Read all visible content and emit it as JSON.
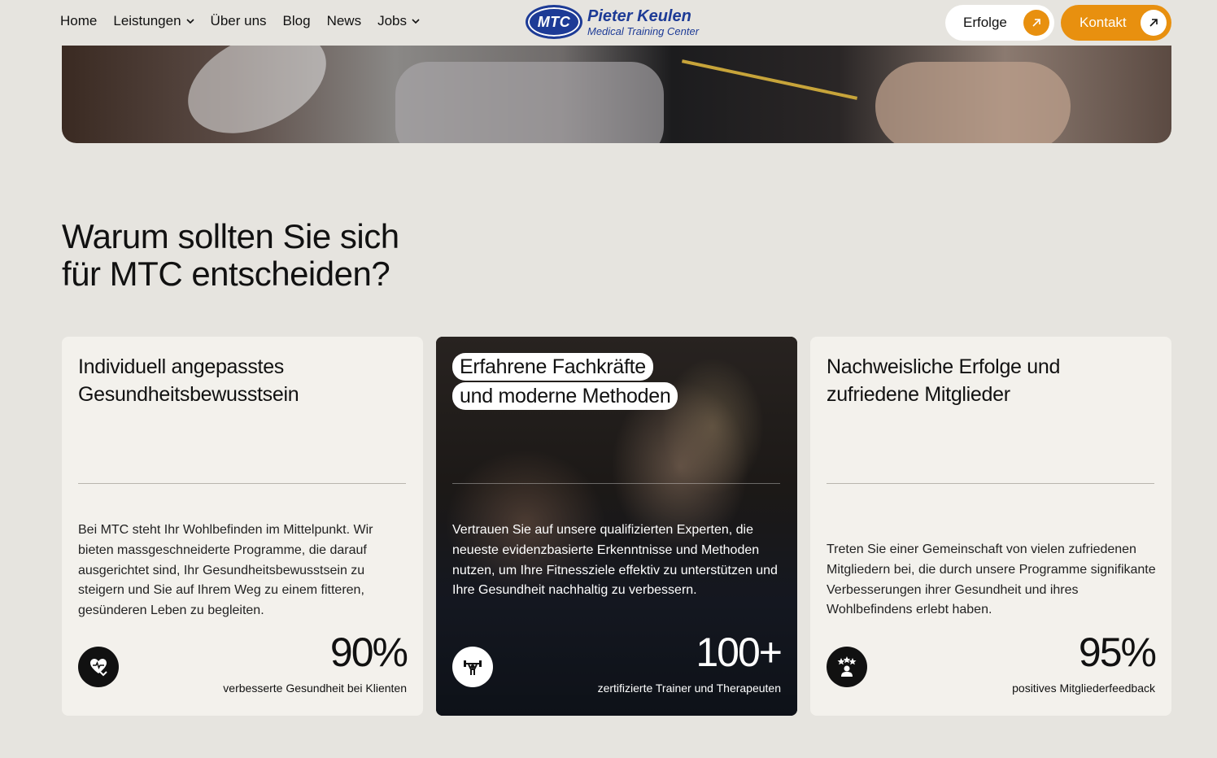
{
  "nav": {
    "items": [
      {
        "label": "Home",
        "has_dropdown": false
      },
      {
        "label": "Leistungen",
        "has_dropdown": true
      },
      {
        "label": "Über uns",
        "has_dropdown": false
      },
      {
        "label": "Blog",
        "has_dropdown": false
      },
      {
        "label": "News",
        "has_dropdown": false
      },
      {
        "label": "Jobs",
        "has_dropdown": true
      }
    ]
  },
  "logo": {
    "mark": "MTC",
    "name": "Pieter Keulen",
    "subtitle": "Medical Training Center"
  },
  "header_buttons": {
    "erfolge_label": "Erfolge",
    "kontakt_label": "Kontakt"
  },
  "section": {
    "heading_line1": "Warum sollten Sie sich",
    "heading_line2": "für MTC entscheiden?"
  },
  "cards": [
    {
      "title": "Individuell angepasstes Gesundheitsbewusstsein",
      "description": "Bei MTC steht Ihr Wohlbefinden im Mittelpunkt. Wir bieten massgeschneiderte Programme, die darauf ausgerichtet sind, Ihr Gesundheitsbewusstsein zu steigern und Sie auf Ihrem Weg zu einem fitteren, gesünderen Leben zu begleiten.",
      "stat": "90%",
      "stat_label": "verbesserte Gesundheit bei Klienten",
      "icon": "heart-health-icon"
    },
    {
      "title_line1": "Erfahrene Fachkräfte",
      "title_line2": "und moderne Methoden",
      "description": "Vertrauen Sie auf unsere qualifizierten Experten, die neueste evidenzbasierte Erkenntnisse und Methoden nutzen, um Ihre Fitnessziele effektiv zu unterstützen und Ihre Gesundheit nachhaltig zu verbessern.",
      "stat": "100+",
      "stat_label": "zertifizierte Trainer und Therapeuten",
      "icon": "weightlifter-icon"
    },
    {
      "title": "Nachweisliche Erfolge und zufriedene Mitglieder",
      "description": "Treten Sie einer Gemeinschaft von vielen zufriedenen Mitgliedern bei, die durch unsere Programme signifikante Verbesserungen ihrer Gesundheit und ihres Wohlbefindens erlebt haben.",
      "stat": "95%",
      "stat_label": "positives Mitgliederfeedback",
      "icon": "rated-member-icon"
    }
  ],
  "colors": {
    "background": "#e6e4df",
    "accent": "#e8900f",
    "brand_blue": "#1d3b96",
    "card_bg": "#f3f1ec"
  }
}
